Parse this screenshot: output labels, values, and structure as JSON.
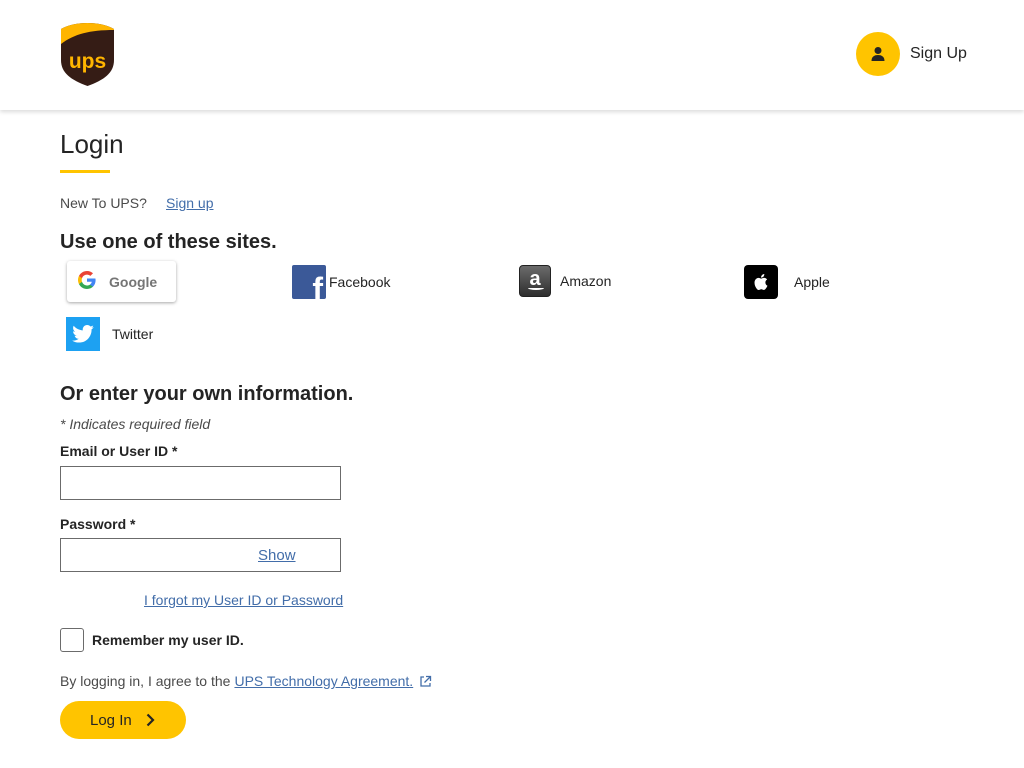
{
  "header": {
    "logo_alt": "UPS",
    "signup_label": "Sign Up"
  },
  "page": {
    "title": "Login",
    "new_to_text": "New To UPS?",
    "signup_link": "Sign up",
    "sites_heading": "Use one of these sites."
  },
  "social": {
    "google": "Google",
    "facebook": "Facebook",
    "amazon": "Amazon",
    "apple": "Apple",
    "twitter": "Twitter"
  },
  "form": {
    "heading": "Or enter your own information.",
    "required_note": "* Indicates required field",
    "email_label": "Email or User ID *",
    "email_value": "",
    "password_label": "Password *",
    "password_value": "",
    "show_label": "Show",
    "forgot_label": "I forgot my User ID or Password",
    "remember_label": "Remember my user ID.",
    "agree_text": "By logging in, I agree to the",
    "agree_link": "UPS Technology Agreement.",
    "login_button": "Log In"
  },
  "colors": {
    "accent": "#ffc400",
    "link": "#426da9",
    "ups_brown": "#351c15",
    "facebook": "#3b5998",
    "twitter": "#1da1f2"
  }
}
